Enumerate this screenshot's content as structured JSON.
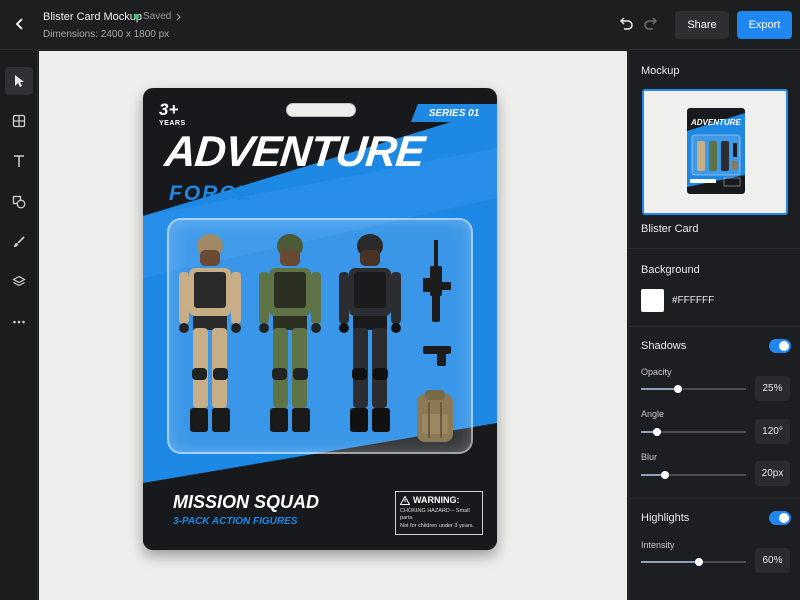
{
  "header": {
    "title": "Blister Card Mockup",
    "status": "Saved",
    "dimensions": "Dimensions: 2400 x 1800 px",
    "share_label": "Share",
    "export_label": "Export"
  },
  "toolbar": {
    "tools": [
      "select-icon",
      "grid-icon",
      "text-icon",
      "shapes-icon",
      "brush-icon",
      "layers-icon",
      "more-icon"
    ]
  },
  "artwork": {
    "age_number": "3+",
    "age_unit": "YEARS",
    "series": "SERIES 01",
    "brand_line1": "ADVENTURE",
    "brand_line2": "FORCE",
    "product_title": "MISSION SQUAD",
    "product_subtitle": "3-PACK ACTION FIGURES",
    "warning_title": "WARNING:",
    "warning_text1": "CHOKING HAZARD – Small parts.",
    "warning_text2": "Not for children under 3 years."
  },
  "panel": {
    "mockup_heading": "Mockup",
    "mockup_name": "Blister Card",
    "background_heading": "Background",
    "background_color": "#FFFFFF",
    "shadows_heading": "Shadows",
    "shadows_enabled": true,
    "opacity_label": "Opacity",
    "opacity_value": "25%",
    "opacity_fraction": 0.25,
    "angle_label": "Angle",
    "angle_value": "120°",
    "angle_fraction": 0.13,
    "blur_label": "Blur",
    "blur_value": "20px",
    "blur_fraction": 0.2,
    "highlights_heading": "Highlights",
    "highlights_enabled": true,
    "intensity_label": "Intensity",
    "intensity_value": "60%",
    "intensity_fraction": 0.6
  },
  "colors": {
    "accent": "#1E88F0",
    "card_blue": "#1E88E5",
    "card_dark": "#17191D"
  }
}
